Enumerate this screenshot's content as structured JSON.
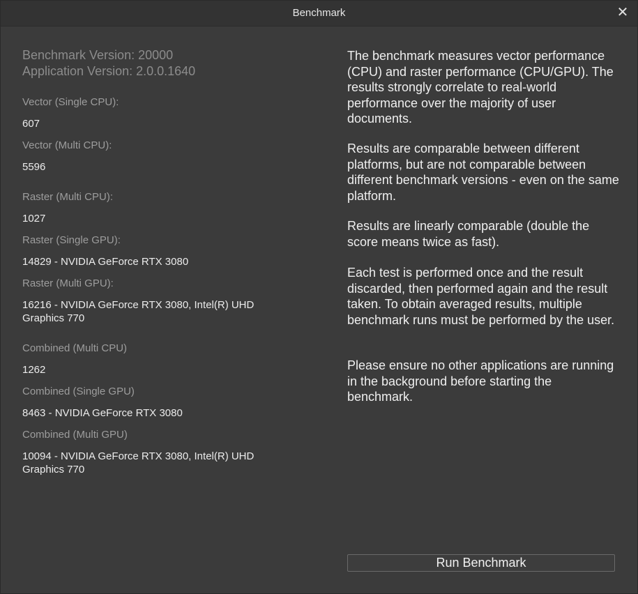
{
  "window": {
    "title": "Benchmark",
    "close_glyph": "✕"
  },
  "versions": {
    "benchmark": "Benchmark Version: 20000",
    "application": "Application Version: 2.0.0.1640"
  },
  "results": [
    {
      "label": "Vector (Single CPU):",
      "value": "607"
    },
    {
      "label": "Vector (Multi CPU):",
      "value": "5596"
    },
    {
      "label": "Raster (Multi CPU):",
      "value": "1027"
    },
    {
      "label": "Raster (Single GPU):",
      "value": "14829 - NVIDIA GeForce RTX 3080"
    },
    {
      "label": "Raster (Multi GPU):",
      "value": "16216 - NVIDIA GeForce RTX 3080, Intel(R) UHD Graphics 770"
    },
    {
      "label": "Combined (Multi CPU)",
      "value": "1262"
    },
    {
      "label": "Combined (Single GPU)",
      "value": "8463 - NVIDIA GeForce RTX 3080"
    },
    {
      "label": "Combined (Multi GPU)",
      "value": "10094 - NVIDIA GeForce RTX 3080, Intel(R) UHD Graphics 770"
    }
  ],
  "description": [
    "The benchmark measures vector performance (CPU) and raster performance (CPU/GPU). The results strongly correlate to real-world performance over the majority of user documents.",
    "Results are comparable between different platforms, but are not comparable between different benchmark versions - even on the same platform.",
    "Results are linearly comparable (double the score means twice as fast).",
    "Each test is performed once and the result discarded, then performed again and the result taken. To obtain averaged results, multiple benchmark runs must be performed by the user.",
    "Please ensure no other applications are running in the background before starting the benchmark."
  ],
  "run_button_label": "Run Benchmark",
  "icons": {
    "close": "close-icon"
  }
}
